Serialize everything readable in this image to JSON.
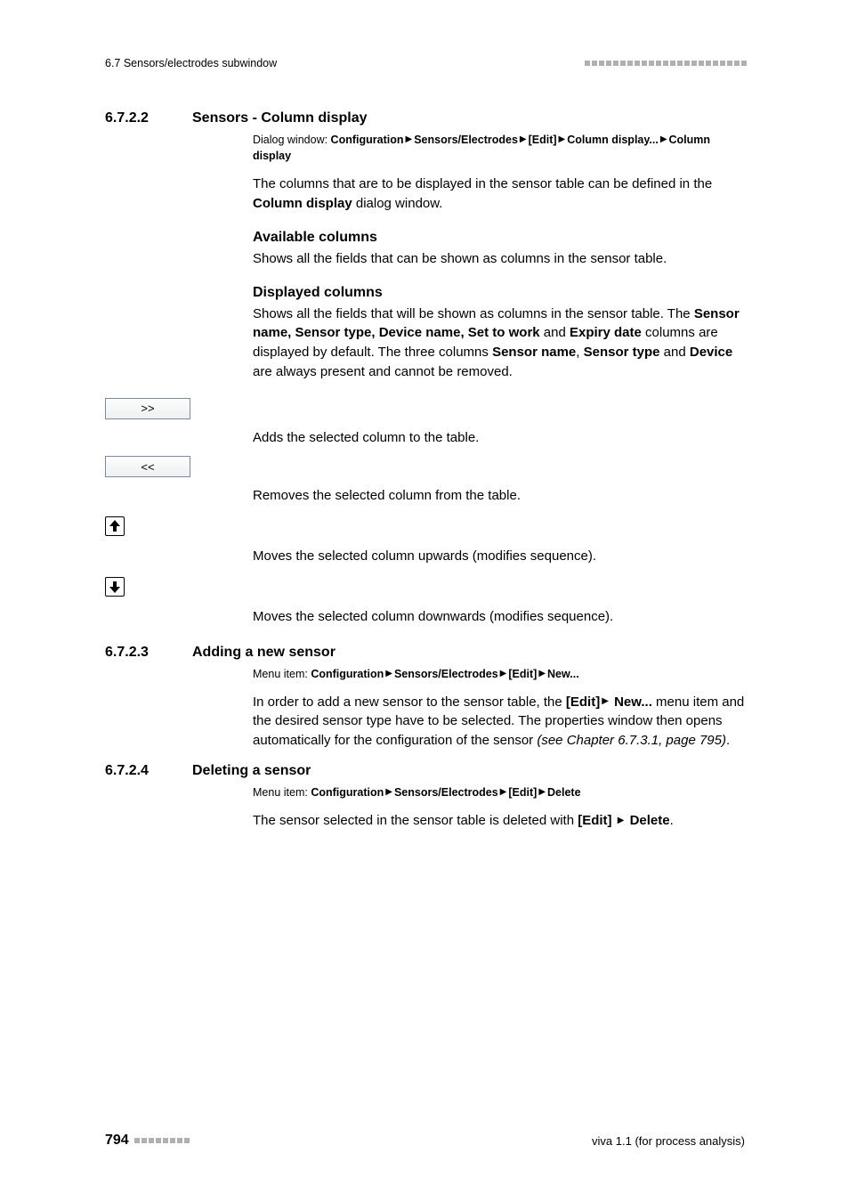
{
  "header": {
    "left": "6.7 Sensors/electrodes subwindow"
  },
  "sec_6722": {
    "num": "6.7.2.2",
    "title": "Sensors - Column display",
    "path_prefix": "Dialog window: ",
    "path_parts": [
      "Configuration",
      "Sensors/Electrodes",
      "[Edit]",
      "Column display...",
      "Column display"
    ],
    "intro_pre": "The columns that are to be displayed in the sensor table can be defined in the ",
    "intro_bold": "Column display",
    "intro_post": " dialog window.",
    "avail_head": "Available columns",
    "avail_text": "Shows all the fields that can be shown as columns in the sensor table.",
    "disp_head": "Displayed columns",
    "disp_text_1": "Shows all the fields that will be shown as columns in the sensor table. The ",
    "disp_bold_1": "Sensor name, Sensor type, Device name, Set to work",
    "disp_text_2": " and ",
    "disp_bold_2": "Expiry date",
    "disp_text_3": " columns are displayed by default. The three columns ",
    "disp_bold_3": "Sensor name",
    "disp_text_4": ", ",
    "disp_bold_4": "Sensor type",
    "disp_text_5": " and ",
    "disp_bold_5": "Device",
    "disp_text_6": " are always present and cannot be removed.",
    "btn_add_label": ">>",
    "btn_add_desc": "Adds the selected column to the table.",
    "btn_rem_label": "<<",
    "btn_rem_desc": "Removes the selected column from the table.",
    "btn_up_desc": "Moves the selected column upwards (modifies sequence).",
    "btn_down_desc": "Moves the selected column downwards (modifies sequence)."
  },
  "sec_6723": {
    "num": "6.7.2.3",
    "title": "Adding a new sensor",
    "path_prefix": "Menu item: ",
    "path_parts": [
      "Configuration",
      "Sensors/Electrodes",
      "[Edit]",
      "New..."
    ],
    "p1_pre": "In order to add a new sensor to the sensor table, the ",
    "p1_bold1": "[Edit]",
    "p1_tri": " ▸ ",
    "p1_bold2": "New...",
    "p1_mid": " menu item and the desired sensor type have to be selected. The properties window then opens automatically for the configuration of the sensor ",
    "p1_italic": "(see Chapter 6.7.3.1, page 795)",
    "p1_end": "."
  },
  "sec_6724": {
    "num": "6.7.2.4",
    "title": "Deleting a sensor",
    "path_prefix": "Menu item: ",
    "path_parts": [
      "Configuration",
      "Sensors/Electrodes",
      "[Edit]",
      "Delete"
    ],
    "p1_pre": "The sensor selected in the sensor table is deleted with ",
    "p1_bold1": "[Edit]",
    "p1_tri": " ▸ ",
    "p1_bold2": "Delete",
    "p1_end": "."
  },
  "footer": {
    "page": "794",
    "right": "viva 1.1 (for process analysis)"
  }
}
